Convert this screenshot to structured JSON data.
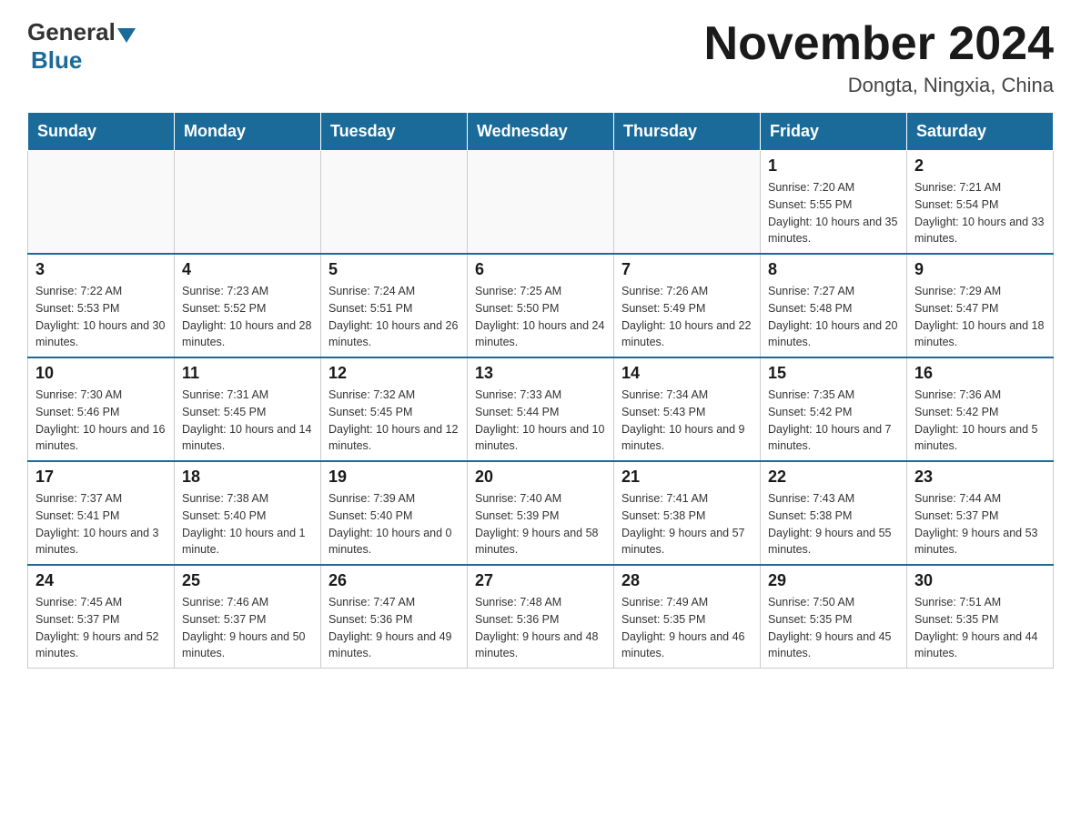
{
  "logo": {
    "general": "General",
    "blue": "Blue"
  },
  "header": {
    "title": "November 2024",
    "subtitle": "Dongta, Ningxia, China"
  },
  "days_of_week": [
    "Sunday",
    "Monday",
    "Tuesday",
    "Wednesday",
    "Thursday",
    "Friday",
    "Saturday"
  ],
  "weeks": [
    [
      {
        "day": "",
        "info": ""
      },
      {
        "day": "",
        "info": ""
      },
      {
        "day": "",
        "info": ""
      },
      {
        "day": "",
        "info": ""
      },
      {
        "day": "",
        "info": ""
      },
      {
        "day": "1",
        "info": "Sunrise: 7:20 AM\nSunset: 5:55 PM\nDaylight: 10 hours and 35 minutes."
      },
      {
        "day": "2",
        "info": "Sunrise: 7:21 AM\nSunset: 5:54 PM\nDaylight: 10 hours and 33 minutes."
      }
    ],
    [
      {
        "day": "3",
        "info": "Sunrise: 7:22 AM\nSunset: 5:53 PM\nDaylight: 10 hours and 30 minutes."
      },
      {
        "day": "4",
        "info": "Sunrise: 7:23 AM\nSunset: 5:52 PM\nDaylight: 10 hours and 28 minutes."
      },
      {
        "day": "5",
        "info": "Sunrise: 7:24 AM\nSunset: 5:51 PM\nDaylight: 10 hours and 26 minutes."
      },
      {
        "day": "6",
        "info": "Sunrise: 7:25 AM\nSunset: 5:50 PM\nDaylight: 10 hours and 24 minutes."
      },
      {
        "day": "7",
        "info": "Sunrise: 7:26 AM\nSunset: 5:49 PM\nDaylight: 10 hours and 22 minutes."
      },
      {
        "day": "8",
        "info": "Sunrise: 7:27 AM\nSunset: 5:48 PM\nDaylight: 10 hours and 20 minutes."
      },
      {
        "day": "9",
        "info": "Sunrise: 7:29 AM\nSunset: 5:47 PM\nDaylight: 10 hours and 18 minutes."
      }
    ],
    [
      {
        "day": "10",
        "info": "Sunrise: 7:30 AM\nSunset: 5:46 PM\nDaylight: 10 hours and 16 minutes."
      },
      {
        "day": "11",
        "info": "Sunrise: 7:31 AM\nSunset: 5:45 PM\nDaylight: 10 hours and 14 minutes."
      },
      {
        "day": "12",
        "info": "Sunrise: 7:32 AM\nSunset: 5:45 PM\nDaylight: 10 hours and 12 minutes."
      },
      {
        "day": "13",
        "info": "Sunrise: 7:33 AM\nSunset: 5:44 PM\nDaylight: 10 hours and 10 minutes."
      },
      {
        "day": "14",
        "info": "Sunrise: 7:34 AM\nSunset: 5:43 PM\nDaylight: 10 hours and 9 minutes."
      },
      {
        "day": "15",
        "info": "Sunrise: 7:35 AM\nSunset: 5:42 PM\nDaylight: 10 hours and 7 minutes."
      },
      {
        "day": "16",
        "info": "Sunrise: 7:36 AM\nSunset: 5:42 PM\nDaylight: 10 hours and 5 minutes."
      }
    ],
    [
      {
        "day": "17",
        "info": "Sunrise: 7:37 AM\nSunset: 5:41 PM\nDaylight: 10 hours and 3 minutes."
      },
      {
        "day": "18",
        "info": "Sunrise: 7:38 AM\nSunset: 5:40 PM\nDaylight: 10 hours and 1 minute."
      },
      {
        "day": "19",
        "info": "Sunrise: 7:39 AM\nSunset: 5:40 PM\nDaylight: 10 hours and 0 minutes."
      },
      {
        "day": "20",
        "info": "Sunrise: 7:40 AM\nSunset: 5:39 PM\nDaylight: 9 hours and 58 minutes."
      },
      {
        "day": "21",
        "info": "Sunrise: 7:41 AM\nSunset: 5:38 PM\nDaylight: 9 hours and 57 minutes."
      },
      {
        "day": "22",
        "info": "Sunrise: 7:43 AM\nSunset: 5:38 PM\nDaylight: 9 hours and 55 minutes."
      },
      {
        "day": "23",
        "info": "Sunrise: 7:44 AM\nSunset: 5:37 PM\nDaylight: 9 hours and 53 minutes."
      }
    ],
    [
      {
        "day": "24",
        "info": "Sunrise: 7:45 AM\nSunset: 5:37 PM\nDaylight: 9 hours and 52 minutes."
      },
      {
        "day": "25",
        "info": "Sunrise: 7:46 AM\nSunset: 5:37 PM\nDaylight: 9 hours and 50 minutes."
      },
      {
        "day": "26",
        "info": "Sunrise: 7:47 AM\nSunset: 5:36 PM\nDaylight: 9 hours and 49 minutes."
      },
      {
        "day": "27",
        "info": "Sunrise: 7:48 AM\nSunset: 5:36 PM\nDaylight: 9 hours and 48 minutes."
      },
      {
        "day": "28",
        "info": "Sunrise: 7:49 AM\nSunset: 5:35 PM\nDaylight: 9 hours and 46 minutes."
      },
      {
        "day": "29",
        "info": "Sunrise: 7:50 AM\nSunset: 5:35 PM\nDaylight: 9 hours and 45 minutes."
      },
      {
        "day": "30",
        "info": "Sunrise: 7:51 AM\nSunset: 5:35 PM\nDaylight: 9 hours and 44 minutes."
      }
    ]
  ]
}
